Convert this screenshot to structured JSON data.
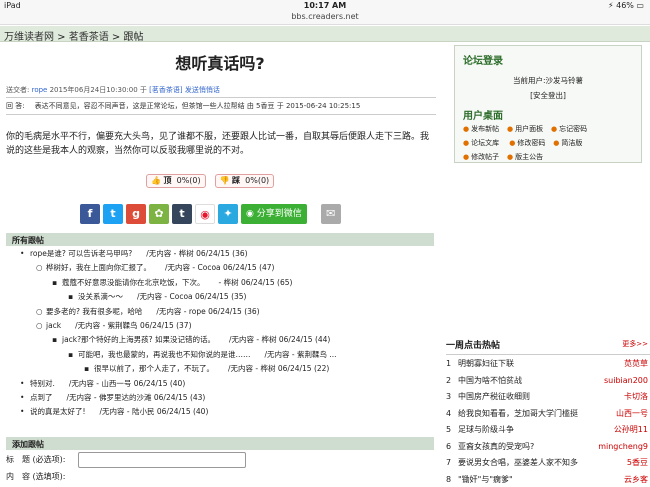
{
  "status": {
    "device": "iPad",
    "time": "10:17 AM",
    "battery": "46%"
  },
  "url": "bbs.creaders.net",
  "breadcrumb": {
    "site": "万维读者网",
    "sep1": " > ",
    "forum": "茗香茶语",
    "sep2": " > ",
    "page": "跟帖"
  },
  "post": {
    "title": "想听真话吗?",
    "meta_prefix": "送交者:",
    "author": "rope",
    "meta_date": "2015年06月24日10:30:00 于",
    "meta_forum": "[茗香茶语]",
    "meta_suffix": "发送悄悄话",
    "catalog_label": "回 答:",
    "catalog_text": "表达不同意见，容忍不同声音，这是正常论坛，但茶馆一些人拉帮结 由 5香豆 于 2015-06-24 10:25:15",
    "body": "你的毛病是水平不行，偏要充大头鸟，见了谁都不服，还要跟人比试一番，自取其辱后便跟人走下三路。我说的这些是我本人的观察，当然你可以反驳我哪里说的不对。"
  },
  "votes": {
    "up_label": "顶",
    "up_count": "0%(0)",
    "down_label": "踩",
    "down_count": "0%(0)"
  },
  "share": {
    "wechat_label": "分享到微信"
  },
  "replies_header": "所有跟帖",
  "replies": [
    {
      "indent": 0,
      "bullet": "•",
      "text": "rope是谁? 可以告诉老马甲吗?",
      "info": "/无内容 - 桦树 06/24/15 (36)"
    },
    {
      "indent": 1,
      "bullet": "○",
      "text": "桦树好，我在上面向你汇报了。",
      "info": "/无内容 - Cocoa 06/24/15 (47)"
    },
    {
      "indent": 2,
      "bullet": "▪",
      "text": "蔻蔻不好意思没能请你在北京吃饭，下次。",
      "info": "- 桦树 06/24/15 (65)"
    },
    {
      "indent": 3,
      "bullet": "▪",
      "text": "没关系滴～～",
      "info": "/无内容 - Cocoa 06/24/15 (35)"
    },
    {
      "indent": 1,
      "bullet": "○",
      "text": "要多老的? 我有很多呢，哈哈",
      "info": "/无内容 - rope 06/24/15 (36)"
    },
    {
      "indent": 1,
      "bullet": "○",
      "text": "jack",
      "info": "/无内容 - 紫荆鞣鸟 06/24/15 (37)"
    },
    {
      "indent": 2,
      "bullet": "▪",
      "text": "jack?那个特好的上海男孩? 如果没记错的话。",
      "info": "/无内容 - 桦树 06/24/15 (44)"
    },
    {
      "indent": 3,
      "bullet": "▪",
      "text": "可能吧，我也最蒙的，再说我也不知你说的是谁……",
      "info": "/无内容 - 紫荆鞣鸟 ..."
    },
    {
      "indent": 4,
      "bullet": "▪",
      "text": "很早以前了，那个人走了，不玩了。",
      "info": "/无内容 - 桦树 06/24/15 (22)"
    },
    {
      "indent": 0,
      "bullet": "•",
      "text": "特别对.",
      "info": "/无内容 - 山西一号 06/24/15 (40)"
    },
    {
      "indent": 0,
      "bullet": "•",
      "text": "点到了",
      "info": "/无内容 - 佛罗里达的沙滩 06/24/15 (43)"
    },
    {
      "indent": 0,
      "bullet": "•",
      "text": "说的真是太好了!",
      "info": "/无内容 - 陆小民 06/24/15 (40)"
    }
  ],
  "add_reply_header": "添加跟帖",
  "form": {
    "title_label": "标　题 (必选项):",
    "content_label": "内　容 (选填项):"
  },
  "sidebar": {
    "login_title": "论坛登录",
    "current_user": "当前用户:沙发马铃薯",
    "logout": "[安全登出]",
    "desk_title": "用户桌面",
    "menu": [
      "发布新帖",
      "用户面板",
      "忘记密码",
      "论坛文库",
      "修改密码",
      "简洁版",
      "修改帖子",
      "版主公告"
    ]
  },
  "hot": {
    "title": "一周点击热帖",
    "more": "更多>>",
    "items": [
      {
        "n": "1",
        "title": "明朝寡妇征下联",
        "author": "苋苋草"
      },
      {
        "n": "2",
        "title": "中国为啥不怕贫战",
        "author": "suibian200"
      },
      {
        "n": "3",
        "title": "中国房产税征收细则",
        "author": "卡切洛"
      },
      {
        "n": "4",
        "title": "给我良知看看，芝加哥大学门槛挺",
        "author": "山西一号"
      },
      {
        "n": "5",
        "title": "足球与阶级斗争",
        "author": "公孙明11"
      },
      {
        "n": "6",
        "title": "亚裔女孩真的受宠吗?",
        "author": "mingcheng9"
      },
      {
        "n": "7",
        "title": "要说男女合唱，巫婆差人家不知多",
        "author": "5香豆"
      },
      {
        "n": "8",
        "title": "\"锄奸\"与\"瘸爹\"",
        "author": "云乡客"
      }
    ]
  }
}
